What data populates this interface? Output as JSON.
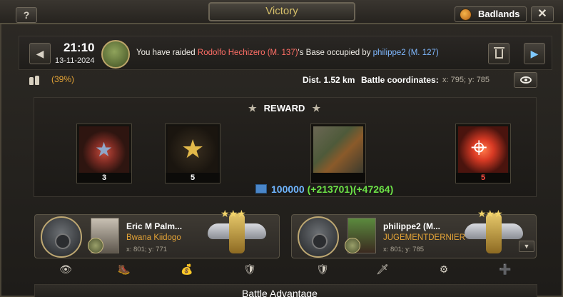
{
  "window": {
    "help_label": "?",
    "title": "Victory",
    "region": "Badlands",
    "close_label": "✕"
  },
  "message": {
    "prev_label": "◀",
    "next_label": "▶",
    "time": "21:10",
    "date": "13-11-2024",
    "text_prefix": "You have raided ",
    "target_name": "Rodolfo Hechizero (M. 137)",
    "text_middle": "'s Base occupied by ",
    "occupier_name": "philippe2 (M. 127)"
  },
  "info": {
    "percent": "(39%)",
    "distance": "Dist. 1.52 km",
    "coords_label": "Battle coordinates:",
    "coords": "x: 795; y: 785"
  },
  "reward": {
    "title": "REWARD",
    "star_glyph": "★",
    "items": [
      {
        "icon": "medal-star-icon",
        "count": "3"
      },
      {
        "icon": "laurel-star-icon",
        "count": "5"
      },
      {
        "icon": "supply-crate-icon",
        "count": ""
      },
      {
        "icon": "target-icon",
        "count": "5"
      }
    ],
    "resource_base": "100000",
    "resource_gain1": "(+213701)",
    "resource_gain2": "(+47264)"
  },
  "players": [
    {
      "name": "Eric M Palm...",
      "guild": "Bwana Kiidogo",
      "coords": "x: 801; y: 771",
      "actions": [
        "👁",
        "🥾",
        "💰",
        "🛡"
      ]
    },
    {
      "name": "philippe2 (M...",
      "guild": "JUGEMENTDERNIER",
      "coords": "x: 801; y: 785",
      "actions": [
        "🛡",
        "🗡",
        "⚙",
        "➕"
      ]
    }
  ],
  "advantage": {
    "title": "Battle Advantage"
  },
  "colors": {
    "accent_gold": "#d7c06a",
    "enemy_red": "#ff6e66",
    "ally_blue": "#7fb8ff",
    "gain_green": "#6ce247",
    "warning_orange": "#e5a437"
  }
}
